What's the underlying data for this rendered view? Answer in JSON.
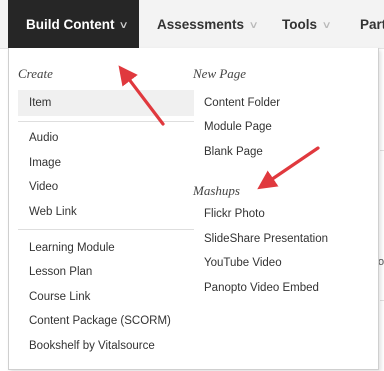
{
  "menubar": {
    "items": [
      {
        "label": "Build Content"
      },
      {
        "label": "Assessments"
      },
      {
        "label": "Tools"
      },
      {
        "label": "Part"
      }
    ],
    "chevron": "∨"
  },
  "dropdown": {
    "left": {
      "title": "Create",
      "group1": [
        "Item"
      ],
      "group2": [
        "Audio",
        "Image",
        "Video",
        "Web Link"
      ],
      "group3": [
        "Learning Module",
        "Lesson Plan",
        "Course Link",
        "Content Package (SCORM)",
        "Bookshelf by Vitalsource"
      ]
    },
    "right": {
      "new_page_title": "New Page",
      "new_page_items": [
        "Content Folder",
        "Module Page",
        "Blank Page"
      ],
      "mashups_title": "Mashups",
      "mashups_items": [
        "Flickr Photo",
        "SlideShare Presentation",
        "YouTube Video",
        "Panopto Video Embed"
      ]
    }
  },
  "annotations": {
    "arrow_color": "#e0393e"
  },
  "background": {
    "edge_text": "o"
  }
}
